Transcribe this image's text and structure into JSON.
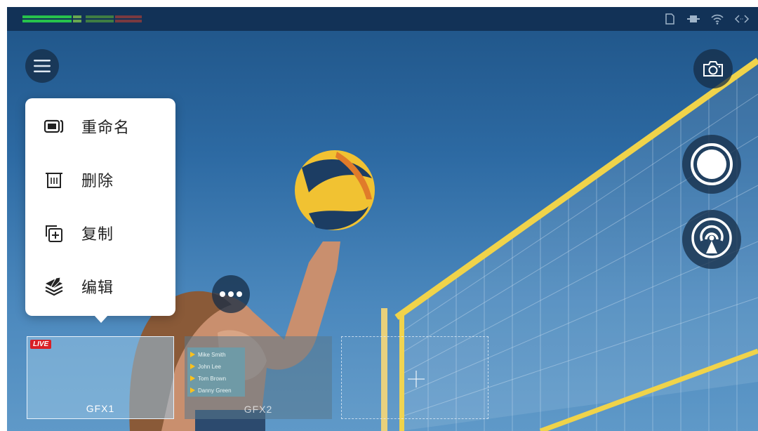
{
  "context_menu": {
    "items": [
      {
        "label": "重命名",
        "icon": "rename-icon"
      },
      {
        "label": "删除",
        "icon": "trash-icon"
      },
      {
        "label": "复制",
        "icon": "duplicate-icon"
      },
      {
        "label": "编辑",
        "icon": "edit-layers-icon"
      }
    ]
  },
  "gfx": {
    "cards": [
      {
        "label": "GFX1",
        "badge": "LIVE"
      },
      {
        "label": "GFX2",
        "players": [
          "Mike Smith",
          "John Lee",
          "Tom Brown",
          "Danny Green"
        ]
      },
      {
        "label": ""
      }
    ]
  },
  "controls": {
    "menu_icon": "hamburger-icon",
    "camera_icon": "camera-icon",
    "record_icon": "record-icon",
    "stream_icon": "broadcast-icon",
    "more_icon": "more-dots-icon"
  },
  "status_icons": [
    "sd-card-icon",
    "battery-icon",
    "wifi-icon",
    "code-icon"
  ],
  "colors": {
    "live_badge": "#d81f26",
    "status_bar": "#123257",
    "meter_green": "#27c24c",
    "meter_red": "#d9363e",
    "net_yellow": "#f0d34a"
  }
}
